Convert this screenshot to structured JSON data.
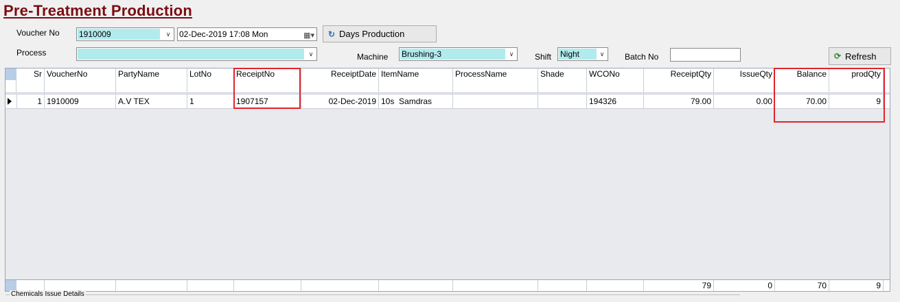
{
  "title": "Pre-Treatment Production",
  "form": {
    "voucher_label": "Voucher No",
    "voucher_value": "1910009",
    "date_value": "02-Dec-2019 17:08 Mon",
    "days_production_label": "Days Production",
    "process_label": "Process",
    "process_value": "",
    "machine_label": "Machine",
    "machine_value": "Brushing-3",
    "shift_label": "Shift",
    "shift_value": "Night",
    "batch_label": "Batch No",
    "batch_value": "",
    "refresh_label": "Refresh"
  },
  "grid": {
    "columns": [
      "Sr",
      "VoucherNo",
      "PartyName",
      "LotNo",
      "ReceiptNo",
      "ReceiptDate",
      "ItemName",
      "ProcessName",
      "Shade",
      "WCONo",
      "ReceiptQty",
      "IssueQty",
      "Balance",
      "prodQty"
    ],
    "rows": [
      [
        "1",
        "1910009",
        "A.V TEX",
        "1",
        "1907157",
        "02-Dec-2019",
        "10s  Samdras",
        "",
        "",
        "194326",
        "79.00",
        "0.00",
        "70.00",
        "9"
      ]
    ],
    "totals": {
      "receipt_qty": "79",
      "issue_qty": "0",
      "balance": "70",
      "prod_qty": "9"
    }
  },
  "section_label": "Chemicals Issue Details",
  "colors": {
    "title": "#7b0d12",
    "highlight": "#b2ebee",
    "annotation": "#e0232b"
  }
}
